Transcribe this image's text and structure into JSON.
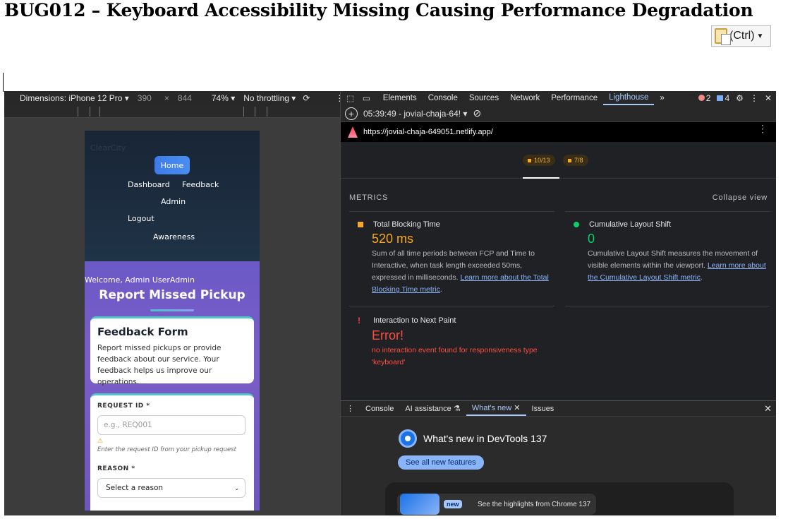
{
  "doc": {
    "title": "BUG012 – Keyboard Accessibility Missing Causing Performance Degradation",
    "paste_label": "(Ctrl)"
  },
  "device_toolbar": {
    "dimensions": "Dimensions: iPhone 12 Pro",
    "width": "390",
    "x": "×",
    "height": "844",
    "zoom": "74%",
    "throttling": "No throttling"
  },
  "app": {
    "brand": "ClearCity",
    "nav": [
      "Home",
      "Dashboard",
      "Feedback",
      "Admin",
      "Logout",
      "Awareness"
    ],
    "welcome": "Welcome, Admin UserAdmin",
    "title": "Report Missed Pickup",
    "feedback_card": {
      "heading": "Feedback Form",
      "text": "Report missed pickups or provide feedback about our service. Your feedback helps us improve our operations."
    },
    "form": {
      "request_label": "REQUEST ID *",
      "request_placeholder": "e.g., REQ001",
      "warn_icon": "⚠",
      "request_hint": "Enter the request ID from your pickup request",
      "reason_label": "REASON *",
      "reason_value": "Select a reason"
    }
  },
  "devtools": {
    "tabs": [
      "Elements",
      "Console",
      "Sources",
      "Network",
      "Performance",
      "Lighthouse"
    ],
    "active_tab": "Lighthouse",
    "error_count": "2",
    "message_count": "4",
    "report_time": "05:39:49 - jovial-chaja-64!",
    "url": "https://jovial-chaja-649051.netlify.app/",
    "pills": [
      "10/13",
      "7/8"
    ],
    "metrics_label": "METRICS",
    "collapse_label": "Collapse view",
    "metrics": [
      {
        "name": "Total Blocking Time",
        "value": "520 ms",
        "color": "#f8a823",
        "desc": "Sum of all time periods between FCP and Time to Interactive, when task length exceeded 50ms, expressed in milliseconds.",
        "link": "Learn more about the Total Blocking Time metric",
        "end": "."
      },
      {
        "name": "Cumulative Layout Shift",
        "value": "0",
        "color": "#0cce6b",
        "desc": "Cumulative Layout Shift measures the movement of visible elements within the viewport.",
        "link": "Learn more about the Cumulative Layout Shift metric",
        "end": "."
      },
      {
        "name": "Interaction to Next Paint",
        "value": "Error!",
        "color": "#ff4e42",
        "desc": "no interaction event found for responsiveness type 'keyboard'"
      }
    ],
    "drawer_tabs": [
      "Console",
      "AI assistance",
      "What's new",
      "Issues"
    ],
    "active_drawer_tab": "What's new",
    "whats_new_title": "What's new in DevTools 137",
    "see_all": "See all new features",
    "new_badge": "new",
    "highlights": "See the highlights from Chrome 137"
  }
}
